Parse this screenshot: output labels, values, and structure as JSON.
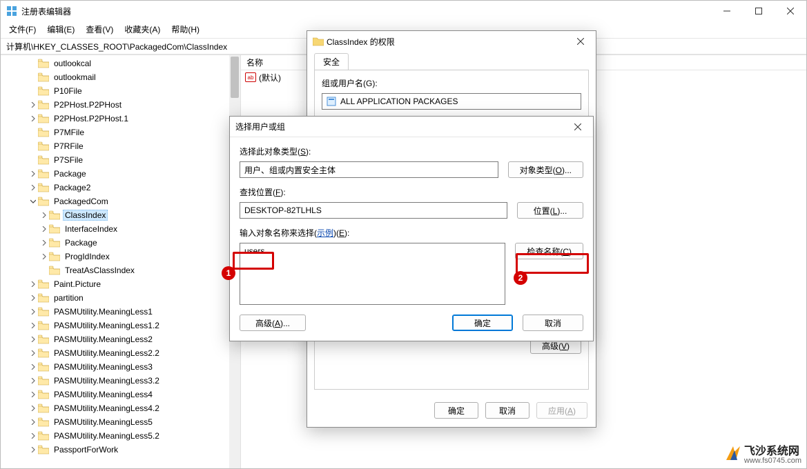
{
  "window": {
    "title": "注册表编辑器"
  },
  "menubar": [
    "文件(F)",
    "编辑(E)",
    "查看(V)",
    "收藏夹(A)",
    "帮助(H)"
  ],
  "address": "计算机\\HKEY_CLASSES_ROOT\\PackagedCom\\ClassIndex",
  "tree": [
    {
      "depth": 2,
      "chev": "",
      "label": "outlookcal"
    },
    {
      "depth": 2,
      "chev": "",
      "label": "outlookmail"
    },
    {
      "depth": 2,
      "chev": "",
      "label": "P10File"
    },
    {
      "depth": 2,
      "chev": ">",
      "label": "P2PHost.P2PHost"
    },
    {
      "depth": 2,
      "chev": ">",
      "label": "P2PHost.P2PHost.1"
    },
    {
      "depth": 2,
      "chev": "",
      "label": "P7MFile"
    },
    {
      "depth": 2,
      "chev": "",
      "label": "P7RFile"
    },
    {
      "depth": 2,
      "chev": "",
      "label": "P7SFile"
    },
    {
      "depth": 2,
      "chev": ">",
      "label": "Package"
    },
    {
      "depth": 2,
      "chev": ">",
      "label": "Package2"
    },
    {
      "depth": 2,
      "chev": "v",
      "label": "PackagedCom"
    },
    {
      "depth": 3,
      "chev": ">",
      "label": "ClassIndex",
      "selected": true
    },
    {
      "depth": 3,
      "chev": ">",
      "label": "InterfaceIndex"
    },
    {
      "depth": 3,
      "chev": ">",
      "label": "Package"
    },
    {
      "depth": 3,
      "chev": ">",
      "label": "ProgIdIndex"
    },
    {
      "depth": 3,
      "chev": "",
      "label": "TreatAsClassIndex"
    },
    {
      "depth": 2,
      "chev": ">",
      "label": "Paint.Picture"
    },
    {
      "depth": 2,
      "chev": ">",
      "label": "partition"
    },
    {
      "depth": 2,
      "chev": ">",
      "label": "PASMUtility.MeaningLess1"
    },
    {
      "depth": 2,
      "chev": ">",
      "label": "PASMUtility.MeaningLess1.2"
    },
    {
      "depth": 2,
      "chev": ">",
      "label": "PASMUtility.MeaningLess2"
    },
    {
      "depth": 2,
      "chev": ">",
      "label": "PASMUtility.MeaningLess2.2"
    },
    {
      "depth": 2,
      "chev": ">",
      "label": "PASMUtility.MeaningLess3"
    },
    {
      "depth": 2,
      "chev": ">",
      "label": "PASMUtility.MeaningLess3.2"
    },
    {
      "depth": 2,
      "chev": ">",
      "label": "PASMUtility.MeaningLess4"
    },
    {
      "depth": 2,
      "chev": ">",
      "label": "PASMUtility.MeaningLess4.2"
    },
    {
      "depth": 2,
      "chev": ">",
      "label": "PASMUtility.MeaningLess5"
    },
    {
      "depth": 2,
      "chev": ">",
      "label": "PASMUtility.MeaningLess5.2"
    },
    {
      "depth": 2,
      "chev": ">",
      "label": "PassportForWork"
    }
  ],
  "list": {
    "col_name": "名称",
    "default_value": "(默认)"
  },
  "perm_dialog": {
    "title": "ClassIndex 的权限",
    "tab": "安全",
    "group_label": "组或用户名(G):",
    "entry": "ALL APPLICATION PACKAGES",
    "adv_btn": "高级(V)",
    "ok": "确定",
    "cancel": "取消",
    "apply": "应用(A)"
  },
  "selu_dialog": {
    "title": "选择用户或组",
    "type_label": "选择此对象类型(S):",
    "type_value": "用户、组或内置安全主体",
    "type_btn": "对象类型(O)...",
    "loc_label": "查找位置(F):",
    "loc_value": "DESKTOP-82TLHLS",
    "loc_btn": "位置(L)...",
    "names_label_pre": "输入对象名称来选择(",
    "names_label_link": "示例",
    "names_label_post": ")(E):",
    "names_value": "users",
    "check_btn": "检查名称(C)",
    "adv_btn": "高级(A)...",
    "ok": "确定",
    "cancel": "取消"
  },
  "annotations": {
    "b1": "1",
    "b2": "2"
  },
  "watermark": {
    "name": "飞沙系统网",
    "url": "www.fs0745.com"
  }
}
